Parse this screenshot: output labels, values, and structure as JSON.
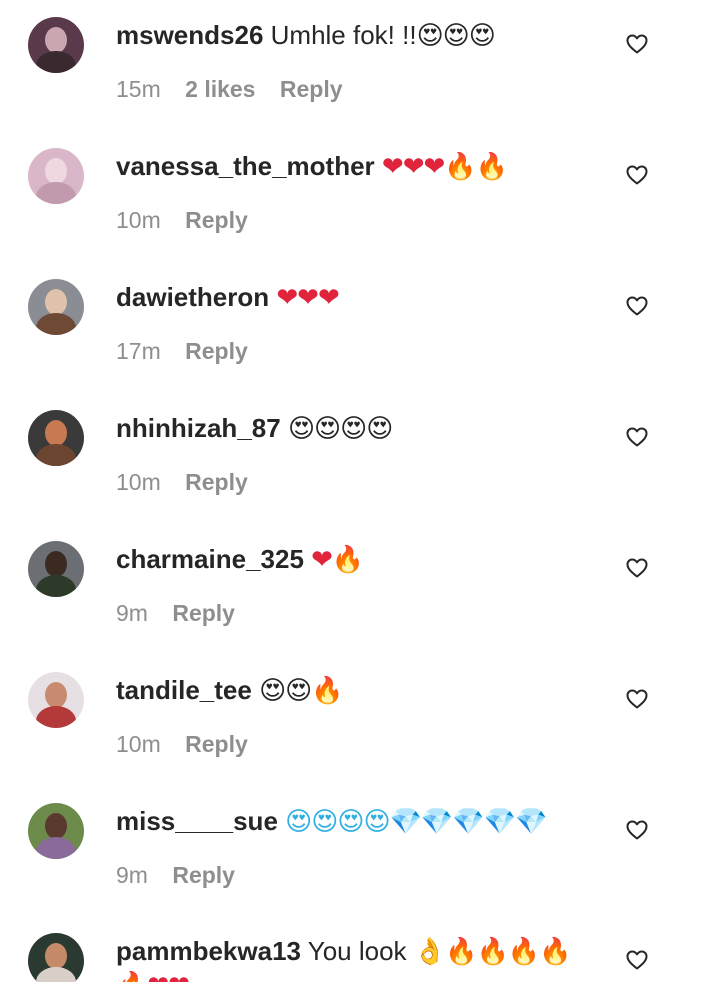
{
  "comments": [
    {
      "username": "mswends26",
      "text": "Umhle fok! !!",
      "emoji": "😍😍😍",
      "time": "15m",
      "likes": "2 likes",
      "reply": "Reply",
      "avatar_colors": [
        "#5a3a4a",
        "#c9a6b0",
        "#3a2a30"
      ]
    },
    {
      "username": "vanessa_the_mother",
      "text": "",
      "emoji": "❤❤❤🔥🔥",
      "time": "10m",
      "likes": "",
      "reply": "Reply",
      "avatar_colors": [
        "#d9b7c8",
        "#f0d8e0",
        "#c29aae"
      ]
    },
    {
      "username": "dawietheron",
      "text": "",
      "emoji": "❤❤❤",
      "time": "17m",
      "likes": "",
      "reply": "Reply",
      "avatar_colors": [
        "#8a8d93",
        "#e0c2aa",
        "#6e4a36"
      ]
    },
    {
      "username": "nhinhizah_87",
      "text": "",
      "emoji": "😍😍😍😍",
      "time": "10m",
      "likes": "",
      "reply": "Reply",
      "avatar_colors": [
        "#3a3a3a",
        "#c77a52",
        "#6b4530"
      ]
    },
    {
      "username": "charmaine_325",
      "text": "",
      "emoji": "❤🔥",
      "time": "9m",
      "likes": "",
      "reply": "Reply",
      "avatar_colors": [
        "#6b6e72",
        "#3b2a22",
        "#2d3a2a"
      ]
    },
    {
      "username": "tandile_tee",
      "text": "",
      "emoji": "😍😍🔥",
      "time": "10m",
      "likes": "",
      "reply": "Reply",
      "avatar_colors": [
        "#e6e0e4",
        "#c98b70",
        "#b43a3a"
      ]
    },
    {
      "username": "miss____sue",
      "text": "",
      "emoji": "😍😍😍😍💎💎💎💎💎",
      "time": "9m",
      "likes": "",
      "reply": "Reply",
      "avatar_colors": [
        "#6c8a4a",
        "#5a3a2e",
        "#8a6a9a"
      ]
    },
    {
      "username": "pammbekwa13",
      "text": "You look",
      "emoji": "👌🔥🔥🔥🔥",
      "emoji_wrap": "🔥❤❤",
      "time": "",
      "likes": "",
      "reply": "",
      "avatar_colors": [
        "#2a3a30",
        "#c58a6a",
        "#d8d0c8"
      ]
    }
  ],
  "icons": {
    "like": "heart-outline-icon"
  },
  "colors": {
    "text": "#262626",
    "meta": "#8e8e8e"
  }
}
